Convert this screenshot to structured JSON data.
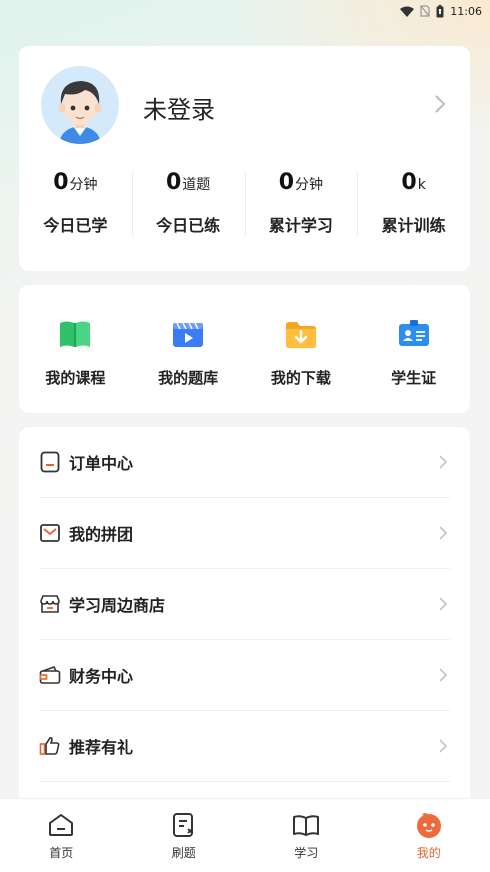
{
  "status_bar": {
    "time": "11:06"
  },
  "profile": {
    "login_text": "未登录",
    "stats": [
      {
        "num": "0",
        "unit": "分钟",
        "label": "今日已学"
      },
      {
        "num": "0",
        "unit": "道题",
        "label": "今日已练"
      },
      {
        "num": "0",
        "unit": "分钟",
        "label": "累计学习"
      },
      {
        "num": "0",
        "unit": "k",
        "label": "累计训练"
      }
    ]
  },
  "quick_links": [
    {
      "label": "我的课程",
      "icon": "book-icon",
      "color": "#2fc26b"
    },
    {
      "label": "我的题库",
      "icon": "video-icon",
      "color": "#3b7cf5"
    },
    {
      "label": "我的下载",
      "icon": "folder-download-icon",
      "color": "#f5a623"
    },
    {
      "label": "学生证",
      "icon": "id-card-icon",
      "color": "#2c8ef0"
    }
  ],
  "menu": [
    {
      "label": "订单中心",
      "icon": "order-icon"
    },
    {
      "label": "我的拼团",
      "icon": "group-buy-icon"
    },
    {
      "label": "学习周边商店",
      "icon": "shop-icon"
    },
    {
      "label": "财务中心",
      "icon": "finance-icon"
    },
    {
      "label": "推荐有礼",
      "icon": "thumbs-up-icon"
    }
  ],
  "tabs": [
    {
      "label": "首页",
      "icon": "home-icon"
    },
    {
      "label": "刷题",
      "icon": "practice-icon"
    },
    {
      "label": "学习",
      "icon": "open-book-icon"
    },
    {
      "label": "我的",
      "icon": "profile-face-icon",
      "active": true
    }
  ],
  "colors": {
    "accent": "#e8632e"
  }
}
